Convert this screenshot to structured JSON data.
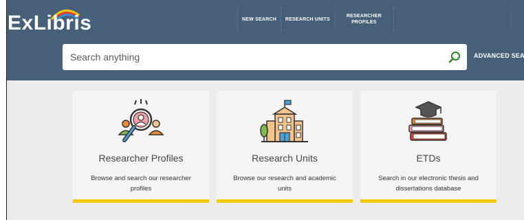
{
  "logo": {
    "text": "ExLibris"
  },
  "nav": {
    "items": [
      "NEW SEARCH",
      "RESEARCH UNITS",
      "RESEARCHER PROFILES"
    ]
  },
  "search": {
    "placeholder": "Search anything",
    "advanced_label": "ADVANCED SEARCH"
  },
  "cards": [
    {
      "title": "Researcher Profiles",
      "description": "Browse and search our researcher profiles",
      "icon": "researcher-search-icon"
    },
    {
      "title": "Research Units",
      "description": "Browse our research and academic units",
      "icon": "building-icon"
    },
    {
      "title": "ETDs",
      "description": "Search in our electronic thesis and dissertations database",
      "icon": "books-graduation-cap-icon"
    }
  ],
  "colors": {
    "header": "#466079",
    "background": "#ececec",
    "card": "#f4f4f4",
    "accent": "#f5c800",
    "search_icon": "#2e8b2e"
  }
}
